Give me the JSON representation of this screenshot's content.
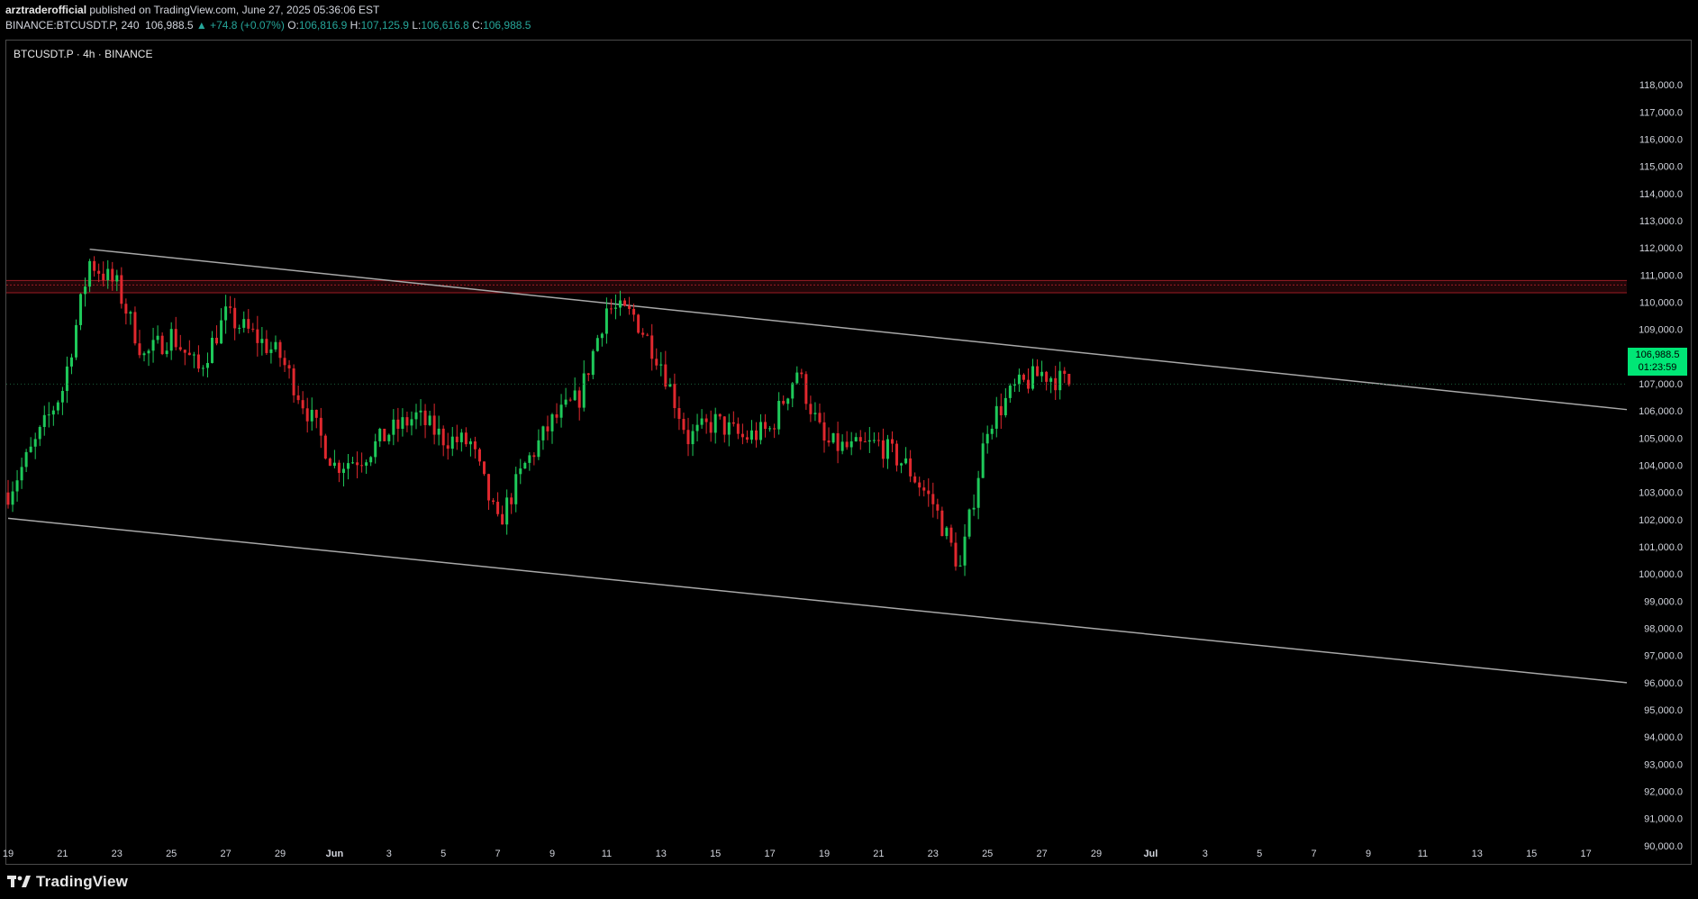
{
  "header": {
    "author": "arztraderofficial",
    "published_text": "published on TradingView.com, June 27, 2025 05:36:06 EST",
    "symbol_full": "BINANCE:BTCUSDT.P, 240",
    "last_price": "106,988.5",
    "change": "▲ +74.8 (+0.07%)",
    "o_label": "O:",
    "o_value": "106,816.9",
    "h_label": "H:",
    "h_value": "107,125.9",
    "l_label": "L:",
    "l_value": "106,616.8",
    "c_label": "C:",
    "c_value": "106,988.5"
  },
  "chart_title": "BTCUSDT.P · 4h · BINANCE",
  "price_tag": {
    "price": "106,988.5",
    "countdown": "01:23:59"
  },
  "footer": {
    "logo_text": "TradingView"
  },
  "colors": {
    "background": "#000000",
    "up": "#26a69a",
    "candle_up": "#1ec95a",
    "candle_down": "#e0282e",
    "resistance_zone": "#9c1c25",
    "channel_line": "#a8a8a8",
    "price_tag": "#00e676"
  },
  "chart_data": {
    "type": "candlestick",
    "title": "BTCUSDT.P · 4h · BINANCE",
    "ylim": [
      89500,
      118500
    ],
    "y_ticks": [
      "118,000.0",
      "117,000.0",
      "116,000.0",
      "115,000.0",
      "114,000.0",
      "113,000.0",
      "112,000.0",
      "111,000.0",
      "110,000.0",
      "109,000.0",
      "108,000.0",
      "107,000.0",
      "106,000.0",
      "105,000.0",
      "104,000.0",
      "103,000.0",
      "102,000.0",
      "101,000.0",
      "100,000.0",
      "99,000.0",
      "98,000.0",
      "97,000.0",
      "96,000.0",
      "95,000.0",
      "94,000.0",
      "93,000.0",
      "92,000.0",
      "91,000.0",
      "90,000.0"
    ],
    "x_ticks": [
      "19",
      "21",
      "23",
      "25",
      "27",
      "29",
      "Jun",
      "3",
      "5",
      "7",
      "9",
      "11",
      "13",
      "15",
      "17",
      "19",
      "21",
      "23",
      "25",
      "27",
      "29",
      "Jul",
      "3",
      "5",
      "7",
      "9",
      "11",
      "13",
      "15",
      "17"
    ],
    "zone": {
      "from": 110350,
      "to": 110800
    },
    "channel": [
      {
        "name": "upper",
        "points": [
          {
            "date": "May 22",
            "value": 111950
          },
          {
            "date": "Jul 18",
            "value": 106050
          }
        ]
      },
      {
        "name": "lower",
        "points": [
          {
            "date": "May 19",
            "value": 102050
          },
          {
            "date": "Jul 18",
            "value": 96000
          }
        ]
      }
    ],
    "price_path": [
      {
        "date": "May 19",
        "value": 103000
      },
      {
        "date": "May 20",
        "value": 104800
      },
      {
        "date": "May 21",
        "value": 106800
      },
      {
        "date": "May 22",
        "value": 111500
      },
      {
        "date": "May 23",
        "value": 110600
      },
      {
        "date": "May 24",
        "value": 108000
      },
      {
        "date": "May 25",
        "value": 108800
      },
      {
        "date": "May 26",
        "value": 107500
      },
      {
        "date": "May 27",
        "value": 109500
      },
      {
        "date": "May 28",
        "value": 108800
      },
      {
        "date": "May 29",
        "value": 108000
      },
      {
        "date": "May 30",
        "value": 106000
      },
      {
        "date": "May 31",
        "value": 104000
      },
      {
        "date": "Jun 1",
        "value": 104300
      },
      {
        "date": "Jun 2",
        "value": 105200
      },
      {
        "date": "Jun 3",
        "value": 105800
      },
      {
        "date": "Jun 4",
        "value": 105000
      },
      {
        "date": "Jun 5",
        "value": 104800
      },
      {
        "date": "Jun 6",
        "value": 101800
      },
      {
        "date": "Jun 7",
        "value": 104000
      },
      {
        "date": "Jun 8",
        "value": 105600
      },
      {
        "date": "Jun 9",
        "value": 106500
      },
      {
        "date": "Jun 10",
        "value": 109800
      },
      {
        "date": "Jun 11",
        "value": 109500
      },
      {
        "date": "Jun 12",
        "value": 107800
      },
      {
        "date": "Jun 13",
        "value": 105000
      },
      {
        "date": "Jun 14",
        "value": 105600
      },
      {
        "date": "Jun 15",
        "value": 105000
      },
      {
        "date": "Jun 16",
        "value": 105300
      },
      {
        "date": "Jun 17",
        "value": 107500
      },
      {
        "date": "Jun 18",
        "value": 104800
      },
      {
        "date": "Jun 19",
        "value": 104600
      },
      {
        "date": "Jun 20",
        "value": 104800
      },
      {
        "date": "Jun 21",
        "value": 104000
      },
      {
        "date": "Jun 22",
        "value": 102600
      },
      {
        "date": "Jun 23",
        "value": 100200
      },
      {
        "date": "Jun 24",
        "value": 105500
      },
      {
        "date": "Jun 25",
        "value": 106800
      },
      {
        "date": "Jun 26",
        "value": 107400
      },
      {
        "date": "Jun 27",
        "value": 106990
      }
    ]
  }
}
